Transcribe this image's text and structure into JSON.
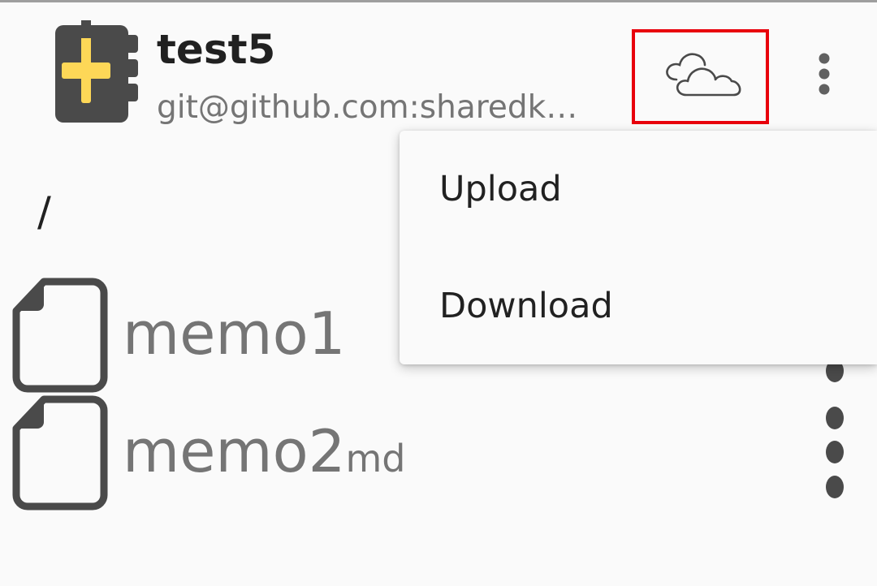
{
  "header": {
    "title": "test5",
    "subtitle": "git@github.com:sharedk…",
    "app_icon": "notebook-plus-icon",
    "sync_icon": "cloud-icon",
    "overflow_icon": "more-vertical-icon"
  },
  "path": "/",
  "files": [
    {
      "name": "memo1",
      "ext": "",
      "icon": "file-icon"
    },
    {
      "name": "memo2",
      "ext": "md",
      "icon": "file-icon"
    }
  ],
  "menu": {
    "items": [
      {
        "label": "Upload"
      },
      {
        "label": "Download"
      }
    ]
  },
  "colors": {
    "highlight": "#e8000c",
    "icon_dark": "#4a4a4a",
    "icon_accent": "#fdd757",
    "text_primary": "#212121",
    "text_secondary": "#757575",
    "background": "#fafafa"
  }
}
